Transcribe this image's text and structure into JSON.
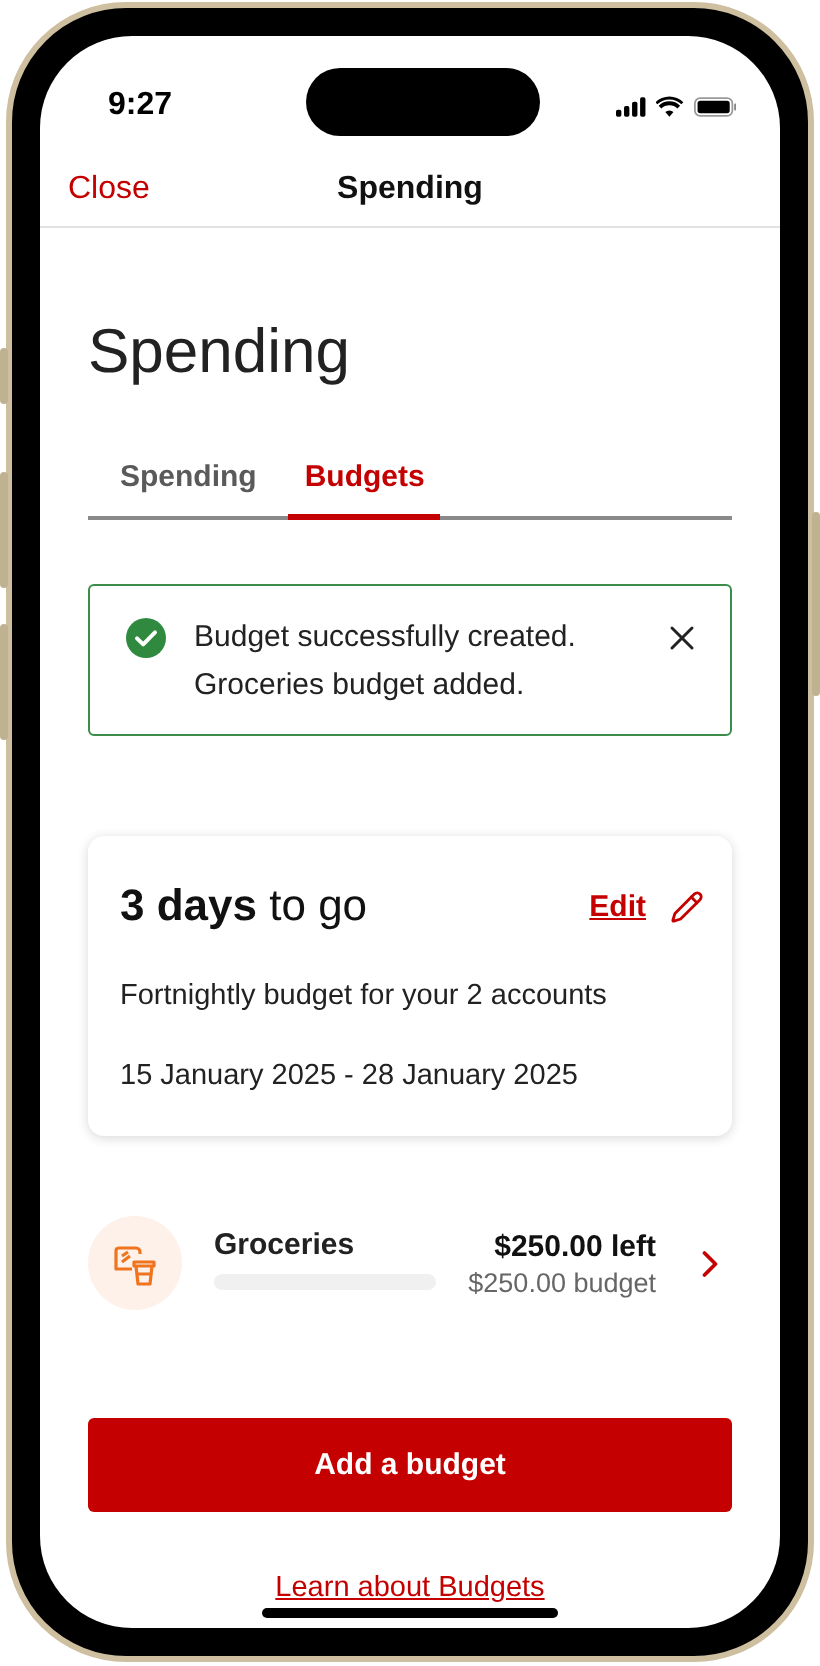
{
  "status_bar": {
    "time": "9:27"
  },
  "nav": {
    "close": "Close",
    "title": "Spending"
  },
  "heading": "Spending",
  "tabs": [
    {
      "label": "Spending",
      "selected": false
    },
    {
      "label": "Budgets",
      "selected": true
    }
  ],
  "alert": {
    "kind": "success",
    "lines": [
      "Budget successfully created.",
      "Groceries budget added."
    ]
  },
  "period_card": {
    "countdown": "**3 days** to go",
    "edit": "Edit",
    "description": "Fortnightly budget for your 2 accounts",
    "dates": "15 January 2025 - 28 January 2025"
  },
  "budgets": [
    {
      "name": "Groceries",
      "remaining": "$250.00 left",
      "budget": "$250.00 budget",
      "level": 0
    }
  ],
  "add_button": "Add a budget",
  "learn_link": "Learn about Budgets"
}
